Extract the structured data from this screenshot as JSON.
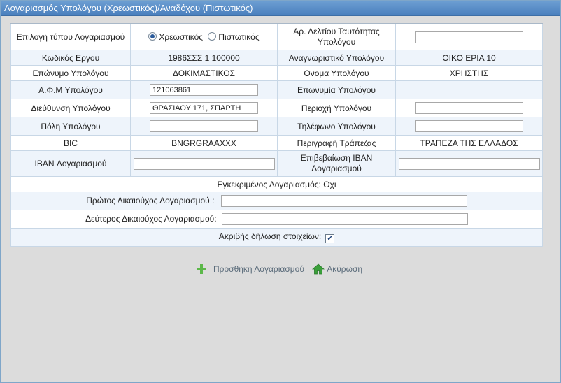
{
  "window": {
    "title": "Λογαριασμός Υπολόγου (Χρεωστικός)/Αναδόχου (Πιστωτικός)"
  },
  "form": {
    "account_type_label": "Επιλογή τύπου Λογαριασμού",
    "radio_debit": "Χρεωστικός",
    "radio_credit": "Πιστωτικός",
    "selected_type": "Χρεωστικός",
    "id_card_label": "Αρ. Δελτίου Ταυτότητας Υπολόγου",
    "id_card_value": "",
    "project_code_label": "Κωδικός Εργου",
    "project_code_value": "1986ΣΣΣ 1 100000",
    "accountant_id_label": "Αναγνωριστικό Υπολόγου",
    "accountant_id_value": "ΟΙΚΟ ΕΡΙΑ 10",
    "surname_label": "Επώνυμο Υπολόγου",
    "surname_value": "ΔΟΚΙΜΑΣΤΙΚΟΣ",
    "name_label": "Ονομα Υπολόγου",
    "name_value": "ΧΡΗΣΤΗΣ",
    "afm_label": "Α.Φ.Μ Υπολόγου",
    "afm_value": "121063861",
    "company_label": "Επωνυμία Υπολόγου",
    "company_value": "",
    "address_label": "Διεύθυνση Υπολόγου",
    "address_value": "ΘΡΑΣΙΑΟΥ 171, ΣΠΑΡΤΗ",
    "region_label": "Περιοχή Υπολόγου",
    "region_value": "",
    "city_label": "Πόλη Υπολόγου",
    "city_value": "",
    "phone_label": "Τηλέφωνο Υπολόγου",
    "phone_value": "",
    "bic_label": "BIC",
    "bic_value": "BNGRGRAAXXX",
    "bank_desc_label": "Περιγραφή Τράπεζας",
    "bank_desc_value": "ΤΡΑΠΕΖΑ ΤΗΣ ΕΛΛΑΔΟΣ",
    "iban_label": "IBAN Λογαριασμού",
    "iban_value": "",
    "iban_confirm_label": "Επιβεβαίωση IBAN Λογαριασμού",
    "iban_confirm_value": "",
    "approved_text": "Εγκεκριμένος Λογαριασμός: Οχι",
    "first_holder_label": "Πρώτος Δικαιούχος Λογαριασμού :",
    "first_holder_value": "",
    "second_holder_label": "Δεύτερος Δικαιούχος Λογαριασμού:",
    "second_holder_value": "",
    "accurate_label": "Ακριβής δήλωση στοιχείων:",
    "accurate_checked": true
  },
  "actions": {
    "add_label": "Προσθήκη Λογαριασμού",
    "cancel_label": "Ακύρωση"
  },
  "icons": {
    "add": "plus-icon",
    "cancel": "home-icon"
  },
  "colors": {
    "title_bar": "#4a7fbd",
    "add_icon": "#5cb84a",
    "home_icon": "#3aa03a"
  }
}
